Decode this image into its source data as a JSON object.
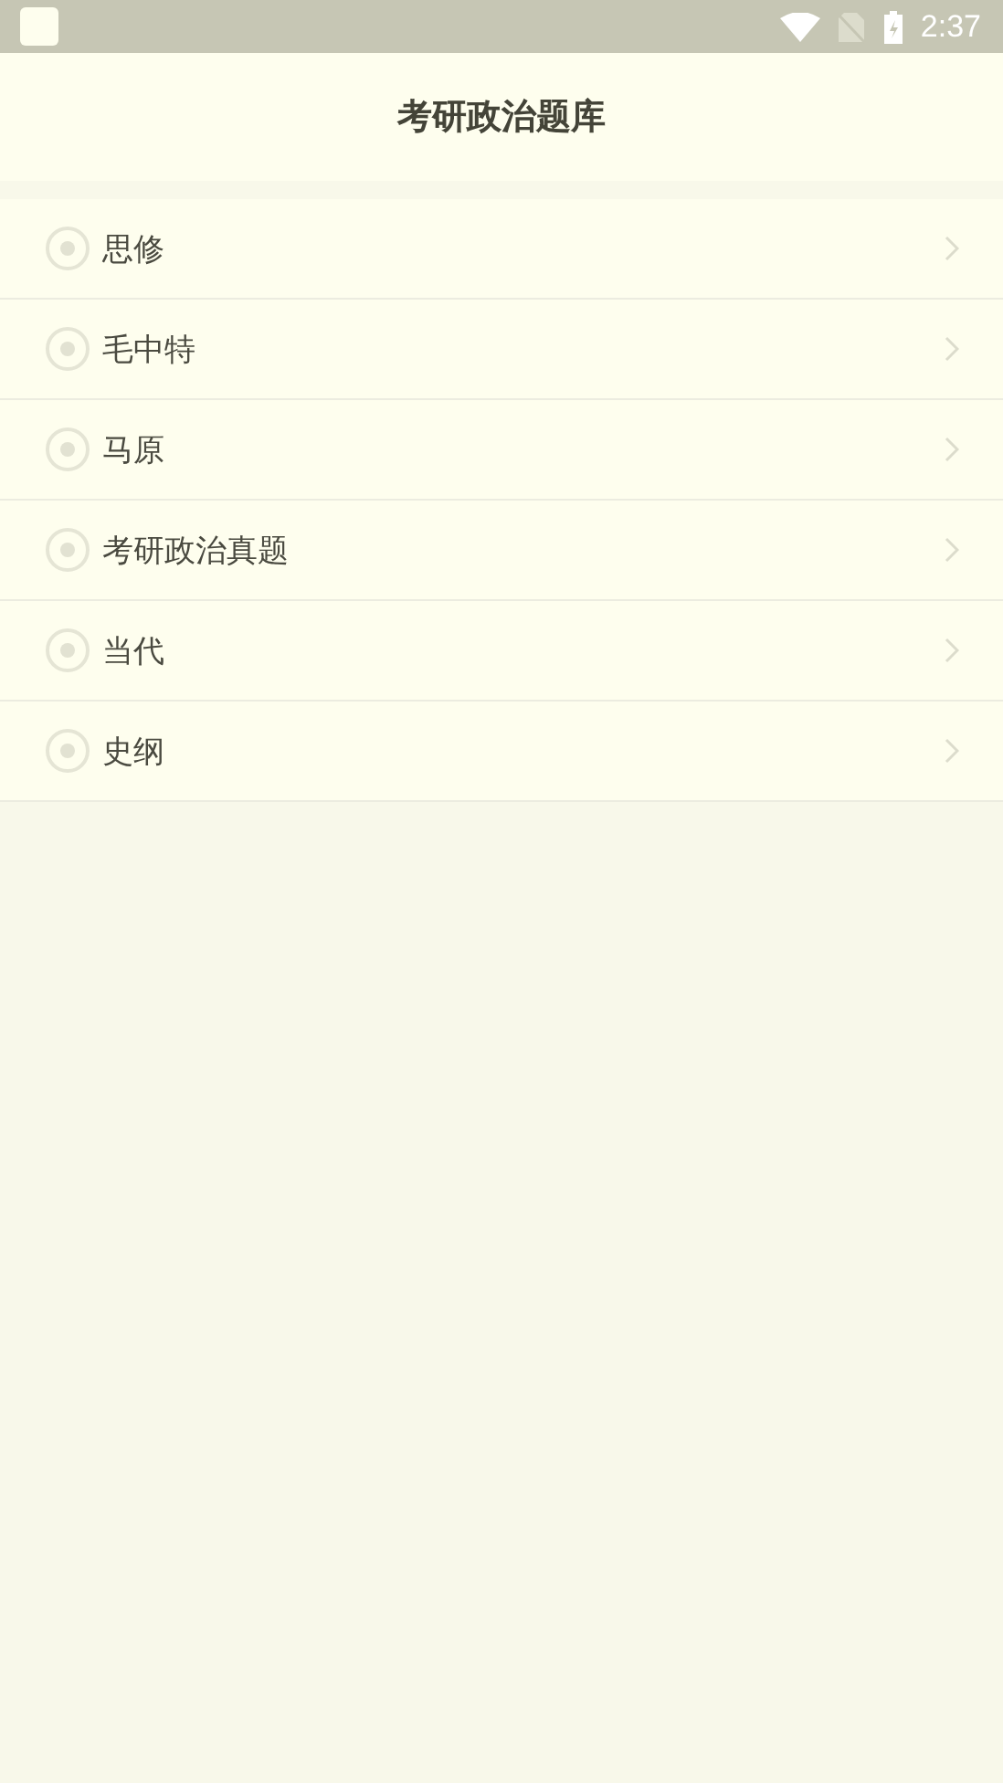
{
  "status_bar": {
    "time": "2:37"
  },
  "header": {
    "title": "考研政治题库"
  },
  "items": [
    {
      "label": "思修"
    },
    {
      "label": "毛中特"
    },
    {
      "label": "马原"
    },
    {
      "label": "考研政治真题"
    },
    {
      "label": "当代"
    },
    {
      "label": "史纲"
    }
  ]
}
